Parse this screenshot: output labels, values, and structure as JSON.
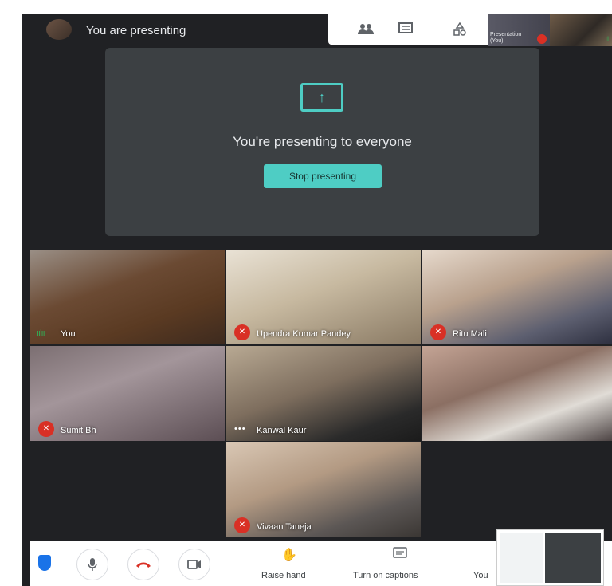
{
  "header": {
    "presenting_label": "You are presenting",
    "participant_tiles": [
      {
        "line1": "Presentation",
        "line2": "(You)"
      }
    ]
  },
  "toolbar_icons": [
    "people-icon",
    "chat-icon",
    "activities-icon"
  ],
  "presentation": {
    "message": "You're presenting to everyone",
    "stop_label": "Stop presenting",
    "accent_color": "#4ecdc4"
  },
  "participants": [
    {
      "name": "You",
      "mic": "on"
    },
    {
      "name": "Upendra Kumar Pandey",
      "mic": "off"
    },
    {
      "name": "Ritu Mali",
      "mic": "off"
    },
    {
      "name": "Sumit Bh",
      "mic": "off"
    },
    {
      "name": "Kanwal Kaur",
      "mic": "more"
    },
    {
      "name": "",
      "mic": "none"
    },
    {
      "name": "Vivaan Taneja",
      "mic": "off"
    }
  ],
  "controls": {
    "raise_hand_label": "Raise hand",
    "captions_label": "Turn on captions",
    "you_label": "You",
    "end_call_color": "#d93025"
  }
}
